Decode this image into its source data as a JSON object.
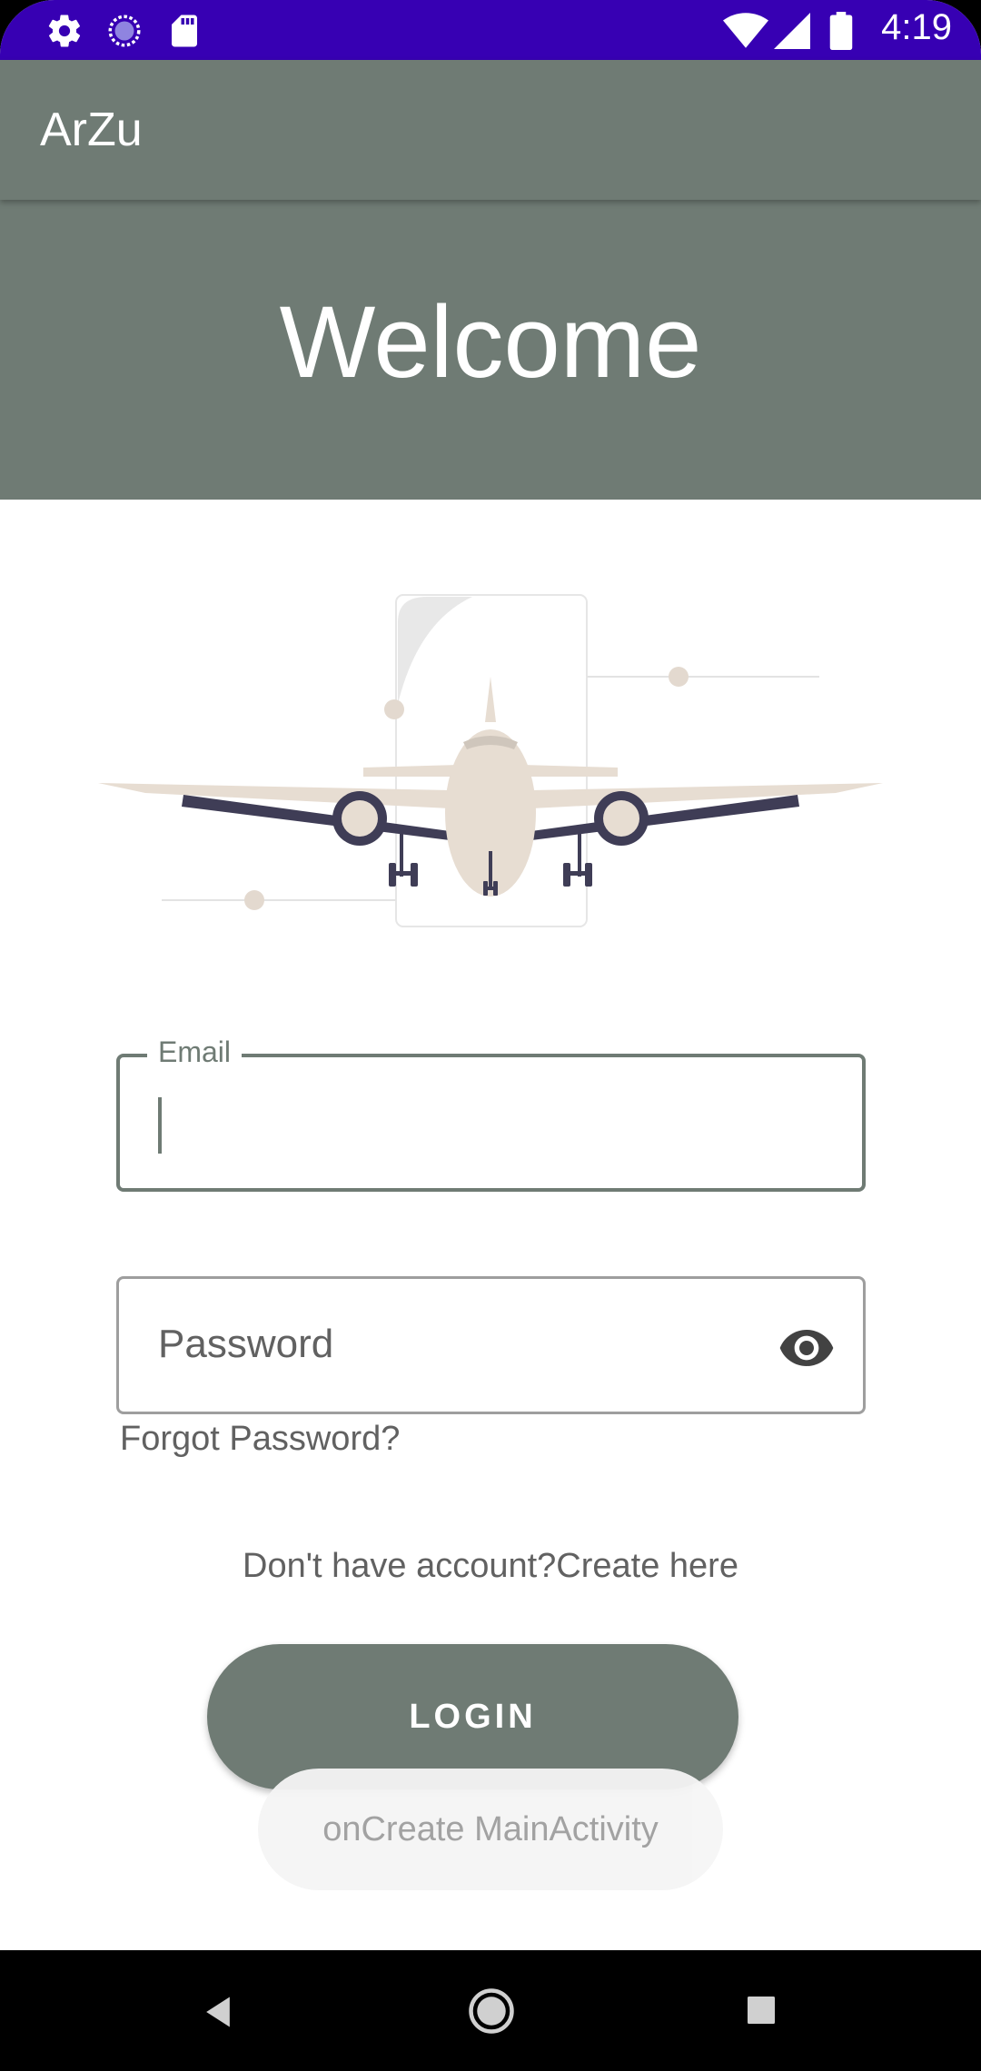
{
  "status_bar": {
    "time": "4:19",
    "left_icons": [
      "settings-icon",
      "sync-icon",
      "sd-card-icon"
    ],
    "right_icons": [
      "wifi-icon",
      "cellular-signal-icon",
      "battery-icon"
    ],
    "color": "#3700b3"
  },
  "app_bar": {
    "title": "ArZu",
    "color": "#6f7b74"
  },
  "banner": {
    "title": "Welcome"
  },
  "login_form": {
    "email_label": "Email",
    "email_value": "",
    "password_placeholder": "Password",
    "password_toggle_icon": "eye-icon",
    "forgot_password": "Forgot Password?",
    "signup_prompt": "Don't have account?Create here",
    "login_button": "LOGIN"
  },
  "toast": {
    "message": "onCreate MainActivity"
  },
  "nav_bar": {
    "buttons": [
      "back-icon",
      "home-icon",
      "recents-icon"
    ]
  }
}
